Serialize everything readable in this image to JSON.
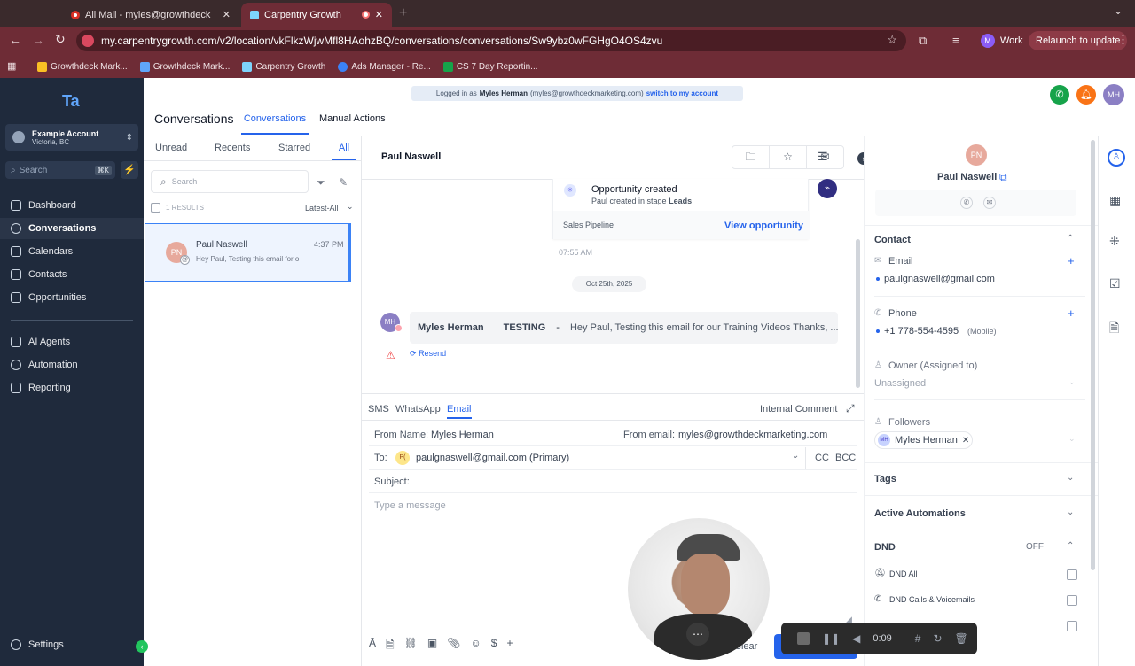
{
  "browser": {
    "tabs": [
      {
        "title": "All Mail - myles@growthdeck"
      },
      {
        "title": "Carpentry Growth"
      }
    ],
    "url": "my.carpentrygrowth.com/v2/location/vkFlkzWjwMfl8HAohzBQ/conversations/conversations/Sw9ybz0wFGHgO4OS4zvu",
    "profile_label": "Work",
    "profile_initial": "M",
    "relaunch_label": "Relaunch to update",
    "bookmarks": [
      "Growthdeck Mark...",
      "Growthdeck Mark...",
      "Carpentry Growth",
      "Ads Manager - Re...",
      "CS 7 Day Reportin..."
    ]
  },
  "sidebar": {
    "account_name": "Example Account",
    "account_location": "Victoria, BC",
    "search_placeholder": "Search",
    "search_shortcut": "⌘K",
    "items": [
      {
        "label": "Dashboard"
      },
      {
        "label": "Conversations"
      },
      {
        "label": "Calendars"
      },
      {
        "label": "Contacts"
      },
      {
        "label": "Opportunities"
      },
      {
        "label": "AI Agents"
      },
      {
        "label": "Automation"
      },
      {
        "label": "Reporting"
      }
    ],
    "settings_label": "Settings"
  },
  "header": {
    "logged_in_prefix": "Logged in as",
    "logged_in_name": "Myles Herman",
    "logged_in_email": "(myles@growthdeckmarketing.com)",
    "switch_label": "switch to my account",
    "title": "Conversations",
    "tabs": [
      {
        "label": "Conversations"
      },
      {
        "label": "Manual Actions"
      }
    ],
    "avatar_initials": "MH"
  },
  "conv_list": {
    "filters": [
      {
        "label": "Unread"
      },
      {
        "label": "Recents"
      },
      {
        "label": "Starred"
      },
      {
        "label": "All"
      }
    ],
    "search_placeholder": "Search",
    "results_label": "1 RESULTS",
    "sort_label": "Latest-All",
    "items": [
      {
        "initials": "PN",
        "name": "Paul Naswell",
        "time": "4:37 PM",
        "preview": "Hey Paul,  Testing this email for o"
      }
    ]
  },
  "thread": {
    "contact_name": "Paul Naswell",
    "opportunity": {
      "title": "Opportunity created",
      "subtitle_prefix": "Paul created in stage",
      "stage": "Leads",
      "pipeline": "Sales Pipeline",
      "link": "View opportunity",
      "time": "07:55 AM"
    },
    "date_divider": "Oct 25th, 2025",
    "message": {
      "initials": "MH",
      "sender": "Myles Herman",
      "subject": "TESTING",
      "separator": "-",
      "body": "Hey Paul,  Testing this email for our Training Videos Thanks,  ...",
      "resend_label": "Resend"
    }
  },
  "composer": {
    "channels": [
      {
        "label": "SMS"
      },
      {
        "label": "WhatsApp"
      },
      {
        "label": "Email"
      }
    ],
    "internal_comment": "Internal Comment",
    "from_name_label": "From Name:",
    "from_name_value": "Myles Herman",
    "from_email_label": "From email:",
    "from_email_value": "myles@growthdeckmarketing.com",
    "to_label": "To:",
    "to_initials": "P(",
    "to_value": "paulgnaswell@gmail.com (Primary)",
    "cc_label": "CC",
    "bcc_label": "BCC",
    "subject_label": "Subject:",
    "message_placeholder": "Type a message",
    "clear_label": "Clear"
  },
  "details": {
    "initials": "PN",
    "name": "Paul Naswell",
    "contact_title": "Contact",
    "email_label": "Email",
    "email_value": "paulgnaswell@gmail.com",
    "phone_label": "Phone",
    "phone_value": "+1 778-554-4595",
    "phone_type": "(Mobile)",
    "owner_label": "Owner (Assigned to)",
    "owner_value": "Unassigned",
    "followers_label": "Followers",
    "follower_initials": "MH",
    "follower_name": "Myles Herman",
    "tags_title": "Tags",
    "automations_title": "Active Automations",
    "dnd_title": "DND",
    "dnd_status": "OFF",
    "dnd_items": [
      {
        "label": "DND All"
      },
      {
        "label": "DND Calls & Voicemails"
      }
    ]
  },
  "recorder": {
    "time": "0:09"
  },
  "colors": {
    "sidebar_bg": "#1f2a3c",
    "accent": "#2563eb",
    "browser_bg": "#6e2c36"
  }
}
